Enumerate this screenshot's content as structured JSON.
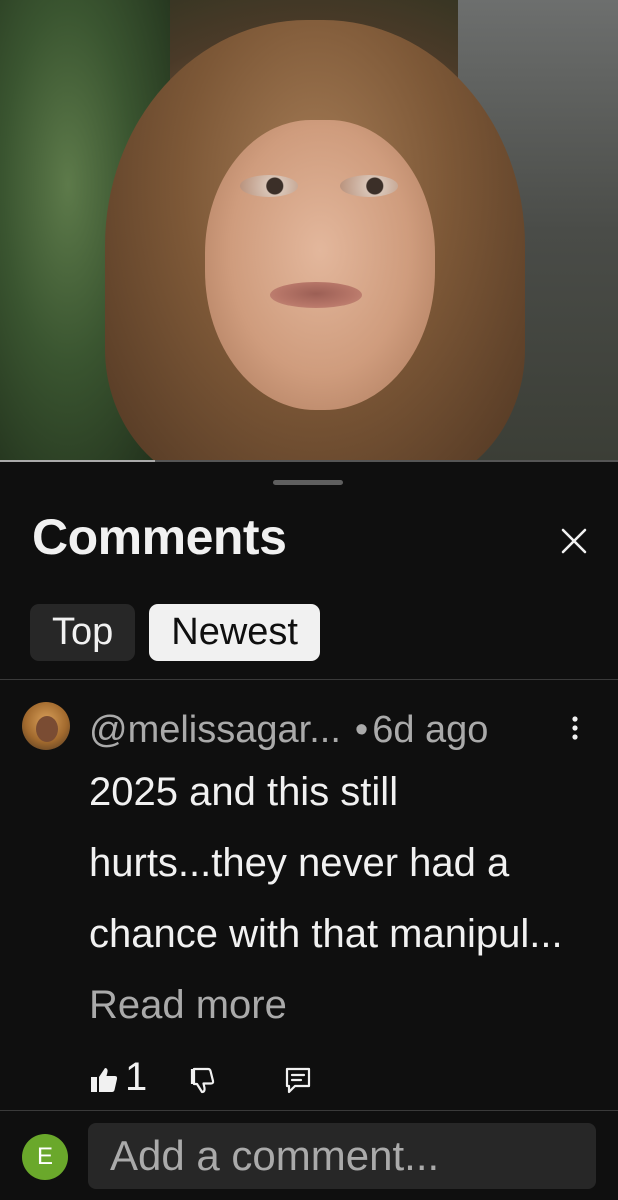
{
  "video": {
    "progress_fraction": 0.25
  },
  "comments_panel": {
    "title": "Comments",
    "close_icon": "close-icon",
    "sort_chips": [
      {
        "label": "Top",
        "active": false
      },
      {
        "label": "Newest",
        "active": true
      }
    ],
    "comments": [
      {
        "author": "@melissagar...",
        "time": "6d ago",
        "text": "2025 and this still hurts...they never had a chance with that manipul...",
        "read_more": "Read more",
        "likes": "1"
      }
    ]
  },
  "composer": {
    "avatar_letter": "E",
    "placeholder": "Add a comment..."
  },
  "colors": {
    "background": "#0f0f0f",
    "chip_inactive": "#272727",
    "chip_active": "#f1f1f1",
    "secondary_text": "#aaaaaa",
    "user_avatar": "#6aa82b"
  }
}
